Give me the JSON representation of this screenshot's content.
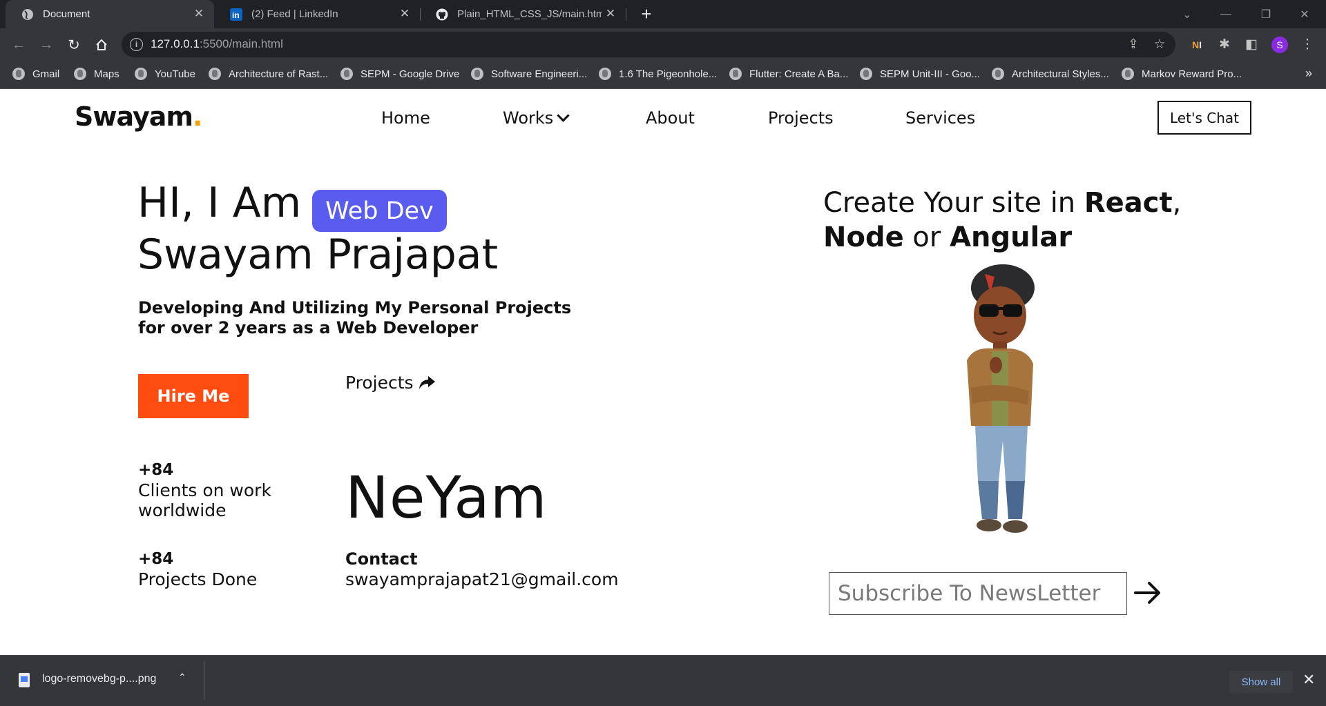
{
  "browser": {
    "tabs": [
      {
        "title": "Document",
        "icon": "globe-icon",
        "active": true
      },
      {
        "title": "(2) Feed | LinkedIn",
        "icon": "linkedin-icon",
        "active": false
      },
      {
        "title": "Plain_HTML_CSS_JS/main.html at",
        "icon": "github-icon",
        "active": false
      }
    ],
    "url_host": "127.0.0.1",
    "url_rest": ":5500/main.html",
    "profile_initial": "S",
    "bookmarks": [
      "Gmail",
      "Maps",
      "YouTube",
      "Architecture of Rast...",
      "SEPM - Google Drive",
      "Software Engineeri...",
      "1.6 The Pigeonhole...",
      "Flutter: Create A Ba...",
      "SEPM Unit-III - Goo...",
      "Architectural Styles...",
      "Markov Reward Pro..."
    ]
  },
  "site": {
    "logo": "Swayam",
    "logo_dot": ".",
    "logo_dot_color": "#f5a000",
    "nav": [
      "Home",
      "Works",
      "About",
      "Projects",
      "Services"
    ],
    "cta": "Let's Chat",
    "hero_greeting": "HI, I Am",
    "hero_badge": "Web Dev",
    "badge_color": "#5a5cf0",
    "hero_name": "Swayam Prajapat",
    "subtitle_line1": "Developing And Utilizing My Personal Projects",
    "subtitle_line2": "for over 2 years as a Web Developer",
    "hire_button": "Hire Me",
    "hire_color": "#ff4d12",
    "projects_link": "Projects",
    "stats": [
      {
        "number": "+84",
        "label_line1": "Clients on work",
        "label_line2": "worldwide"
      },
      {
        "number": "+84",
        "label_line1": "Projects Done",
        "label_line2": ""
      }
    ],
    "brand_big": "NeYam",
    "contact_label": "Contact",
    "contact_email": "swayamprajapat21@gmail.com",
    "promo_prefix": "Create Your site in ",
    "promo_react": "React",
    "promo_comma": ",",
    "promo_node": "Node",
    "promo_or": " or ",
    "promo_angular": "Angular",
    "subscribe_placeholder": "Subscribe To NewsLetter"
  },
  "downloads": {
    "file_name": "logo-removebg-p....png",
    "show_all": "Show all"
  }
}
